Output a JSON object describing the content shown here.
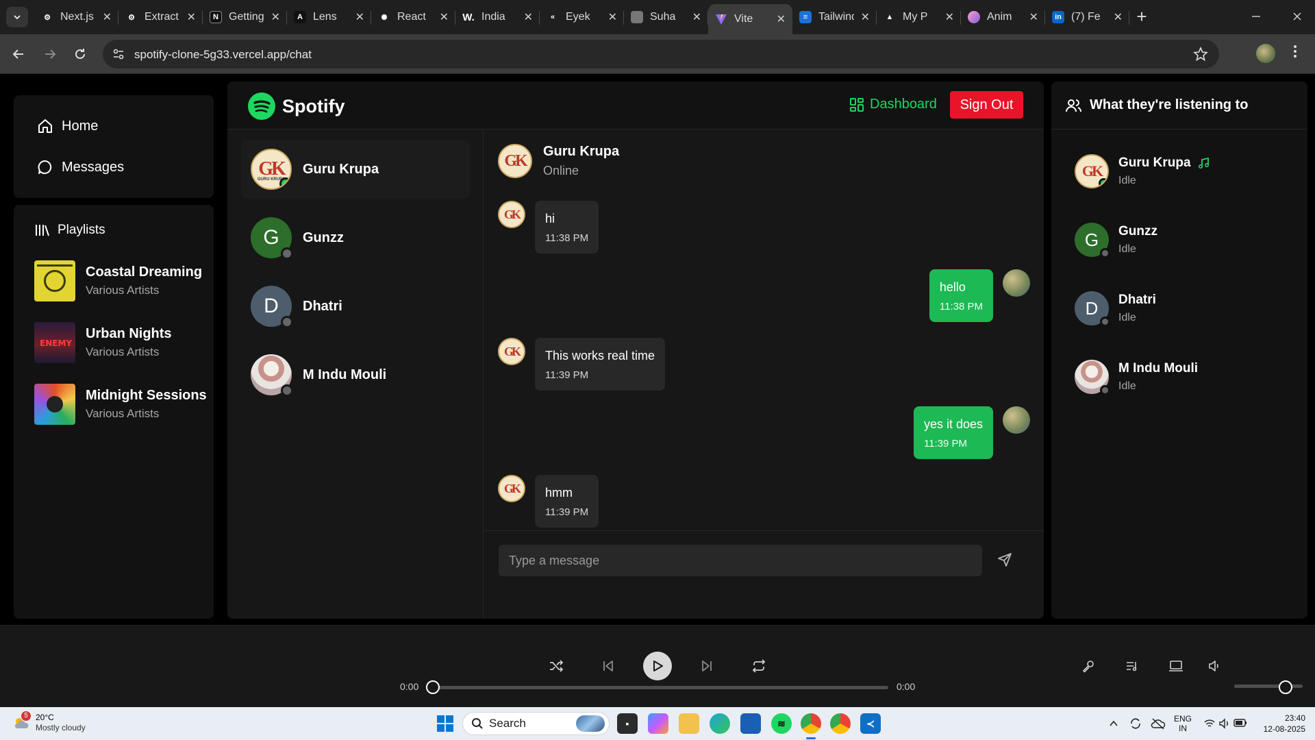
{
  "browser": {
    "tabs": [
      {
        "title": "Next.js",
        "icon": "openai-icon",
        "color": "#2b2b2b"
      },
      {
        "title": "Extract",
        "icon": "openai-icon",
        "color": "#2b2b2b"
      },
      {
        "title": "Getting",
        "icon": "notion-icon",
        "color": "#111111"
      },
      {
        "title": "Lens",
        "icon": "lens-icon",
        "color": "#111111"
      },
      {
        "title": "React",
        "icon": "react-icon",
        "color": "#2b2b2b"
      },
      {
        "title": "India",
        "icon": "wikipedia-icon",
        "color": "#2b2b2b"
      },
      {
        "title": "Eyek",
        "icon": "eyek-icon",
        "color": "#2b2b2b"
      },
      {
        "title": "Suha",
        "icon": "image-icon",
        "color": "#6b6b6b"
      },
      {
        "title": "Vite",
        "icon": "vite-icon",
        "color": "#7b5cff",
        "active": true
      },
      {
        "title": "Tailwind",
        "icon": "tailwind-icon",
        "color": "#1e6fd9"
      },
      {
        "title": "My P",
        "icon": "vercel-icon",
        "color": "#000000"
      },
      {
        "title": "Anim",
        "icon": "anim-icon",
        "color": "#c85ad6"
      },
      {
        "title": "(7) Fe",
        "icon": "linkedin-icon",
        "color": "#0a66c2"
      }
    ],
    "url": "spotify-clone-5g33.vercel.app/chat"
  },
  "sidebar": {
    "nav": [
      {
        "label": "Home",
        "icon": "home-icon"
      },
      {
        "label": "Messages",
        "icon": "message-icon"
      }
    ],
    "playlists_title": "Playlists",
    "playlists": [
      {
        "name": "Coastal Dreaming",
        "artist": "Various Artists"
      },
      {
        "name": "Urban Nights",
        "artist": "Various Artists"
      },
      {
        "name": "Midnight Sessions",
        "artist": "Various Artists"
      }
    ]
  },
  "header": {
    "brand": "Spotify",
    "dashboard_label": "Dashboard",
    "signout_label": "Sign Out"
  },
  "contacts": [
    {
      "name": "Guru Krupa",
      "avatar": "GK",
      "online": true
    },
    {
      "name": "Gunzz",
      "avatar": "G",
      "online": false
    },
    {
      "name": "Dhatri",
      "avatar": "D",
      "online": false
    },
    {
      "name": "M Indu Mouli",
      "avatar": "photo",
      "online": false
    }
  ],
  "conversation": {
    "name": "Guru Krupa",
    "status": "Online",
    "avatar_text": "GK",
    "avatar_subtext": "GURU KRUPA",
    "messages": [
      {
        "dir": "in",
        "text": "hi",
        "time": "11:38 PM"
      },
      {
        "dir": "out",
        "text": "hello",
        "time": "11:38 PM"
      },
      {
        "dir": "in",
        "text": "This works real time",
        "time": "11:39 PM"
      },
      {
        "dir": "out",
        "text": "yes it does",
        "time": "11:39 PM"
      },
      {
        "dir": "in",
        "text": "hmm",
        "time": "11:39 PM"
      }
    ],
    "input_placeholder": "Type a message"
  },
  "friends": {
    "title": "What they're listening to",
    "items": [
      {
        "name": "Guru Krupa",
        "status": "Idle",
        "online": true,
        "playing_icon": true
      },
      {
        "name": "Gunzz",
        "status": "Idle",
        "online": false
      },
      {
        "name": "Dhatri",
        "status": "Idle",
        "online": false
      },
      {
        "name": "M Indu Mouli",
        "status": "Idle",
        "online": false
      }
    ]
  },
  "player": {
    "current_time": "0:00",
    "duration": "0:00",
    "progress": 0,
    "volume": 0.75
  },
  "taskbar": {
    "weather_temp": "20°C",
    "weather_desc": "Mostly cloudy",
    "weather_badge": "5",
    "search_label": "Search",
    "lang_top": "ENG",
    "lang_bottom": "IN",
    "time": "23:40",
    "date": "12-08-2025"
  },
  "colors": {
    "accent": "#1ed760",
    "outgoing_bubble": "#1db954",
    "signout": "#e91429"
  }
}
